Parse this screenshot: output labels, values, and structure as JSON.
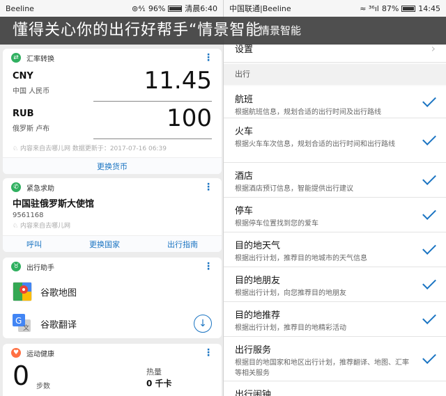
{
  "banner": {
    "text": "懂得关心你的出行好帮手“情景智能",
    "sub": "情景智能"
  },
  "left_status": {
    "carrier": "Beeline",
    "signal": "⊚⁴⁄₁",
    "battery": "96%",
    "battery_level": 0.96,
    "time": "清晨6:40"
  },
  "right_status": {
    "carrier": "中国联通|Beeline",
    "signal": "≈ ³⁶ıl",
    "battery": "87%",
    "battery_level": 0.87,
    "time": "14:45"
  },
  "exchange": {
    "title": "汇率转换",
    "rows": [
      {
        "code": "CNY",
        "name": "中国 人民币",
        "value": "11.45"
      },
      {
        "code": "RUB",
        "name": "俄罗斯 卢布",
        "value": "100"
      }
    ],
    "source": "内容来自去哪儿网 数据更新于：2017-07-16 06:39",
    "action": "更换货币"
  },
  "emergency": {
    "title": "紧急求助",
    "place": "中国驻俄罗斯大使馆",
    "phone": "9561168",
    "source": "内容来自去哪儿网",
    "actions": [
      "呼叫",
      "更换国家",
      "出行指南"
    ]
  },
  "assistant": {
    "title": "出行助手",
    "apps": [
      {
        "name": "谷歌地图"
      },
      {
        "name": "谷歌翻译"
      }
    ]
  },
  "health": {
    "title": "运动健康",
    "steps": "0",
    "steps_label": "步数",
    "cal_label": "热量",
    "cal_value": "0 千卡"
  },
  "settings": {
    "label": "设置"
  },
  "travel_section": "出行",
  "travel_items": [
    {
      "title": "航班",
      "desc": "根据航班信息，规划合适的出行时间及出行路线"
    },
    {
      "title": "火车",
      "desc": "根据火车车次信息，规划合适的出行时间和出行路线"
    },
    {
      "title": "酒店",
      "desc": "根据酒店预订信息，智能提供出行建议"
    },
    {
      "title": "停车",
      "desc": "根据停车位置找到您的爱车"
    },
    {
      "title": "目的地天气",
      "desc": "根据出行计划，推荐目的地城市的天气信息"
    },
    {
      "title": "目的地朋友",
      "desc": "根据出行计划，向您推荐目的地朋友"
    },
    {
      "title": "目的地推荐",
      "desc": "根据出行计划，推荐目的地精彩活动"
    },
    {
      "title": "出行服务",
      "desc": "根据目的地国家和地区出行计划，推荐翻译、地图、汇率等相关服务"
    },
    {
      "title": "出行闹钟",
      "desc": ""
    }
  ]
}
